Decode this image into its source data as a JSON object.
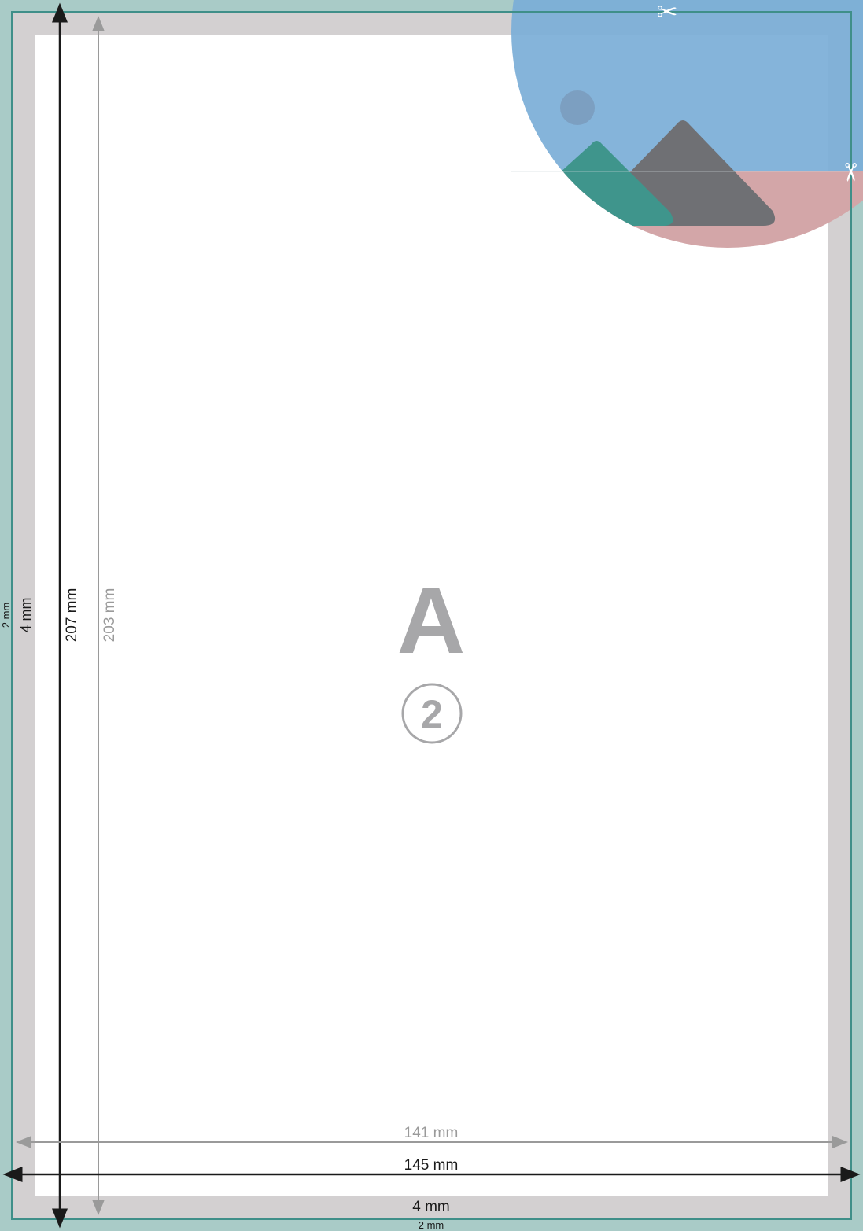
{
  "colors": {
    "bleed": "#a9cbc7",
    "trim": "#d3d0d1",
    "trim_line": "#3f8f89",
    "safe": "#ffffff",
    "black_dim": "#1a1a1a",
    "gray_dim": "#9a9a9a",
    "label_gray": "#a7a7a9",
    "photo_sky": "#7baed7",
    "photo_ground": "#d3a6a8",
    "mountain_dark": "#6f7074",
    "mountain_teal": "#3f958c",
    "sun": "#7c9fc1"
  },
  "labels": {
    "letter": "A",
    "number": "2"
  },
  "dimensions": {
    "bleed_left": "2 mm",
    "margin_left": "4 mm",
    "total_height": "207 mm",
    "safe_height": "203 mm",
    "safe_width": "141 mm",
    "total_width": "145 mm",
    "margin_bottom": "4 mm",
    "bleed_bottom": "2 mm"
  },
  "icons": {
    "cut_top": "scissors-icon",
    "cut_right": "scissors-icon",
    "cut_glyph": "✂"
  }
}
